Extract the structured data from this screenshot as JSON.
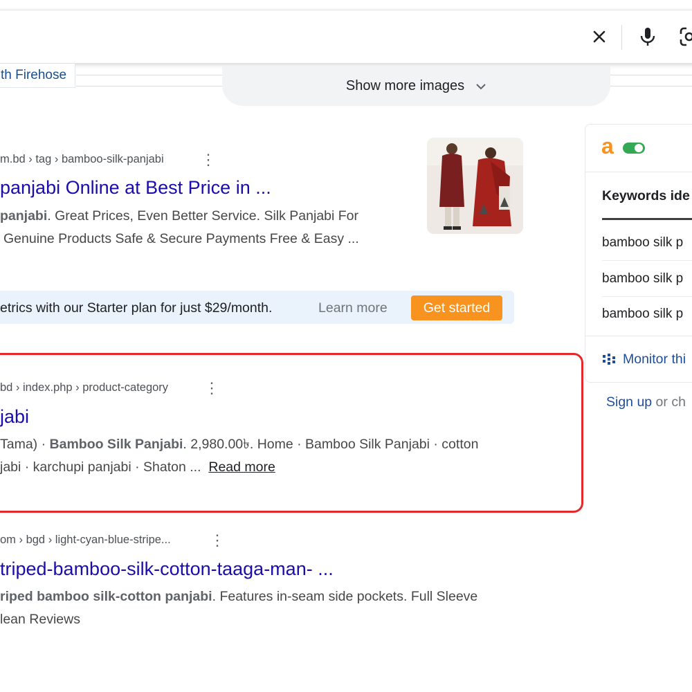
{
  "search": {
    "clear_icon": "close-icon",
    "voice_icon": "microphone-icon",
    "lens_icon": "camera-lens-icon"
  },
  "images": {
    "firehose_chip": "th Firehose",
    "show_more_label": "Show more images"
  },
  "results": [
    {
      "breadcrumb": "m.bd › tag › bamboo-silk-panjabi",
      "title": "panjabi Online at Best Price in ...",
      "snippet_line1_bold": "panjabi",
      "snippet_line1_rest": ". Great Prices, Even Better Service. Silk Panjabi For",
      "snippet_line2": "Genuine Products Safe & Secure Payments Free & Easy ..."
    },
    {
      "breadcrumb": "bd › index.php › product-category",
      "title": "jabi",
      "snippet_line1_a": "Tama) · ",
      "snippet_line1_bold": "Bamboo Silk Panjabi",
      "snippet_line1_b": ". 2,980.00৳. Home · Bamboo Silk Panjabi · cotton",
      "snippet_line2": "jabi · karchupi panjabi · Shaton ...",
      "read_more": "Read more"
    },
    {
      "breadcrumb": "om › bgd › light-cyan-blue-stripe...",
      "title": "triped-bamboo-silk-cotton-taaga-man- ...",
      "snippet_line1_bold": "riped bamboo silk-cotton panjabi",
      "snippet_line1_rest": ". Features in-seam side pockets. Full Sleeve",
      "snippet_line2": "lean Reviews"
    }
  ],
  "promo": {
    "text": "etrics with our Starter plan for just $29/month.",
    "learn_more": "Learn more",
    "cta": "Get started"
  },
  "panel": {
    "logo": "a",
    "heading": "Keywords ide",
    "keywords": [
      "bamboo silk p",
      "bamboo silk p",
      "bamboo silk p"
    ],
    "monitor_label": "Monitor thi",
    "signup_link": "Sign up",
    "signup_rest": " or ch"
  },
  "colors": {
    "link": "#1a0dab",
    "highlight_border": "#e3292a",
    "cta": "#f7931e",
    "toggle": "#34a853"
  }
}
